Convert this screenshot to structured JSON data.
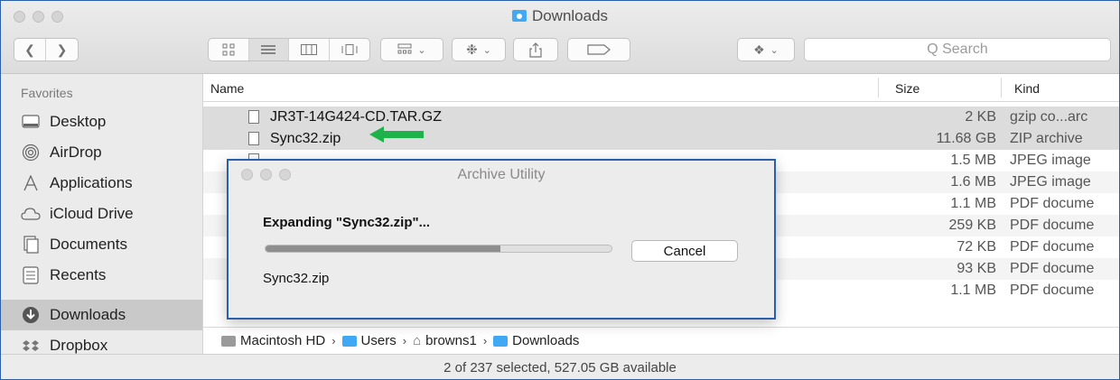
{
  "window": {
    "title": "Downloads"
  },
  "toolbar": {
    "back_icon": "chevron-left",
    "forward_icon": "chevron-right",
    "search_placeholder": "Q Search"
  },
  "sidebar": {
    "heading": "Favorites",
    "items": [
      {
        "label": "Desktop",
        "icon": "desktop-icon",
        "selected": false
      },
      {
        "label": "AirDrop",
        "icon": "airdrop-icon",
        "selected": false
      },
      {
        "label": "Applications",
        "icon": "applications-icon",
        "selected": false
      },
      {
        "label": "iCloud Drive",
        "icon": "cloud-icon",
        "selected": false
      },
      {
        "label": "Documents",
        "icon": "documents-icon",
        "selected": false
      },
      {
        "label": "Recents",
        "icon": "recents-icon",
        "selected": false
      },
      {
        "label": "Downloads",
        "icon": "downloads-icon",
        "selected": true
      },
      {
        "label": "Dropbox",
        "icon": "dropbox-icon",
        "selected": false
      }
    ]
  },
  "list": {
    "columns": {
      "name": "Name",
      "size": "Size",
      "kind": "Kind"
    },
    "rows": [
      {
        "name": "JR3T-14G424-CD.TAR.GZ",
        "size": "2 KB",
        "kind": "gzip co...arc",
        "selected": true
      },
      {
        "name": "Sync32.zip",
        "size": "11.68 GB",
        "kind": "ZIP archive",
        "selected": true
      },
      {
        "name": "",
        "size": "1.5 MB",
        "kind": "JPEG image",
        "selected": false
      },
      {
        "name": "",
        "size": "1.6 MB",
        "kind": "JPEG image",
        "selected": false
      },
      {
        "name": "",
        "size": "1.1 MB",
        "kind": "PDF docume",
        "selected": false
      },
      {
        "name": "",
        "size": "259 KB",
        "kind": "PDF docume",
        "selected": false
      },
      {
        "name": "",
        "size": "72 KB",
        "kind": "PDF docume",
        "selected": false
      },
      {
        "name": "",
        "size": "93 KB",
        "kind": "PDF docume",
        "selected": false
      },
      {
        "name": "",
        "size": "1.1 MB",
        "kind": "PDF docume",
        "selected": false
      }
    ]
  },
  "pathbar": {
    "items": [
      "Macintosh HD",
      "Users",
      "browns1",
      "Downloads"
    ],
    "separator": "›"
  },
  "status": "2 of 237 selected, 527.05 GB available",
  "dialog": {
    "title": "Archive Utility",
    "message": "Expanding \"Sync32.zip\"...",
    "progress": 0.68,
    "cancel_label": "Cancel",
    "filename": "Sync32.zip"
  },
  "colors": {
    "selection_border": "#2b5fa8",
    "arrow": "#1db34a",
    "folder_blue": "#3fa9f5"
  }
}
